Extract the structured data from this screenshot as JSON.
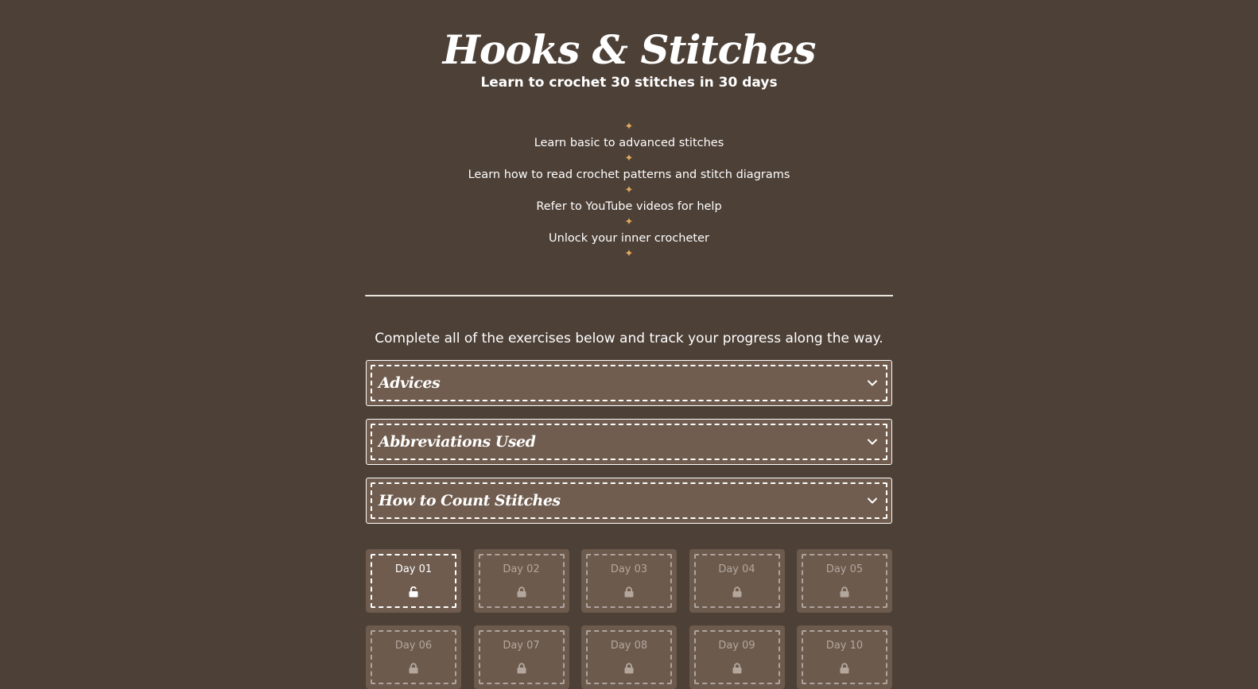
{
  "site": {
    "title": "Hooks & Stitches",
    "tagline": "Learn to crochet 30 stitches in 30 days"
  },
  "features": [
    "Learn basic to advanced stitches",
    "Learn how to read crochet patterns and stitch diagrams",
    "Refer to YouTube videos for help",
    "Unlock your inner crocheter"
  ],
  "star_glyph": "✦",
  "intro_text": "Complete all of the exercises below and track your progress along the way.",
  "accordion": [
    {
      "title": "Advices",
      "icon": "chevron-down-icon"
    },
    {
      "title": "Abbreviations Used",
      "icon": "chevron-down-icon"
    },
    {
      "title": "How to Count Stitches",
      "icon": "chevron-down-icon"
    }
  ],
  "days": [
    {
      "label": "Day 01",
      "state": "unlocked"
    },
    {
      "label": "Day 02",
      "state": "locked"
    },
    {
      "label": "Day 03",
      "state": "locked"
    },
    {
      "label": "Day 04",
      "state": "locked"
    },
    {
      "label": "Day 05",
      "state": "locked"
    },
    {
      "label": "Day 06",
      "state": "locked"
    },
    {
      "label": "Day 07",
      "state": "locked"
    },
    {
      "label": "Day 08",
      "state": "locked"
    },
    {
      "label": "Day 09",
      "state": "locked"
    },
    {
      "label": "Day 10",
      "state": "locked"
    }
  ],
  "colors": {
    "background": "#4d4037",
    "panel": "#705d4f",
    "accent_star": "#e3a95a",
    "locked_text": "#b3a79d",
    "text": "#ffffff"
  }
}
